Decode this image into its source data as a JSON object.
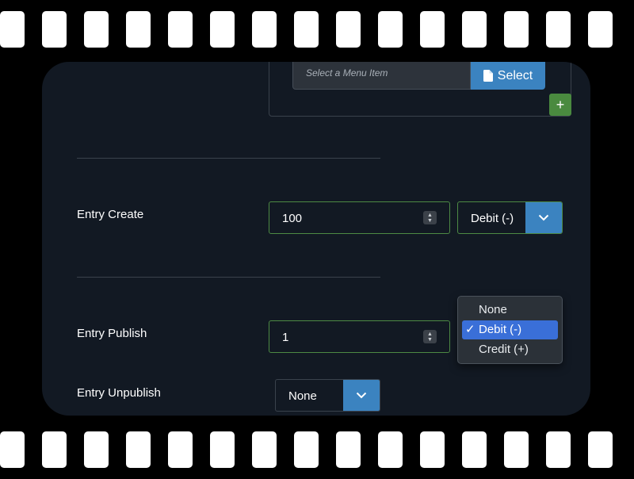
{
  "menu": {
    "placeholder": "Select a Menu Item",
    "select_label": "Select",
    "add_label": "+"
  },
  "entry_create": {
    "label": "Entry Create",
    "value": "100",
    "type": "Debit (-)"
  },
  "entry_publish": {
    "label": "Entry Publish",
    "value": "1"
  },
  "entry_unpublish": {
    "label": "Entry Unpublish",
    "value": "None"
  },
  "dropdown": {
    "options": [
      "None",
      "Debit (-)",
      "Credit (+)"
    ],
    "selected": "Debit (-)",
    "check": "✓"
  },
  "colors": {
    "panel": "#121923",
    "accent_blue": "#3b83c0",
    "valid_green": "#4d8a44",
    "add_green": "#4a8a3f",
    "highlight": "#3a6fd8"
  }
}
